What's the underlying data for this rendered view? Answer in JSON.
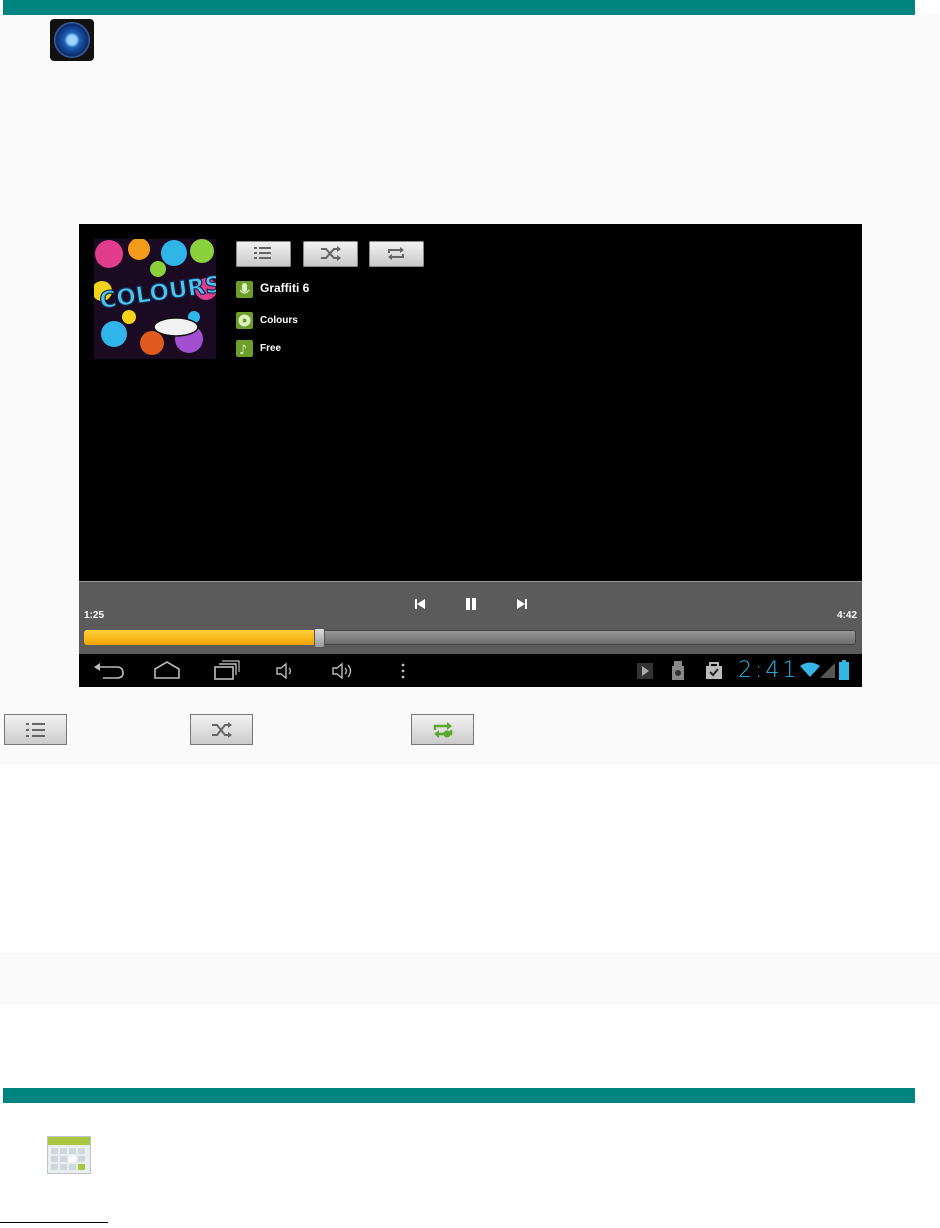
{
  "player": {
    "song_title": "Graffiti 6",
    "album": "Colours",
    "artist": "Free",
    "elapsed": "1:25",
    "duration": "4:42",
    "progress_fraction": 0.305,
    "clock": "2:41",
    "album_art_text": "COLOURS"
  },
  "colors": {
    "teal": "#00847f",
    "accent_yellow": "#f1a300",
    "clock_blue": "#33b5e5",
    "icon_green": "#6d9e2a"
  },
  "icons": {
    "top": "speaker-icon",
    "bottom": "calendar-grid-icon"
  }
}
